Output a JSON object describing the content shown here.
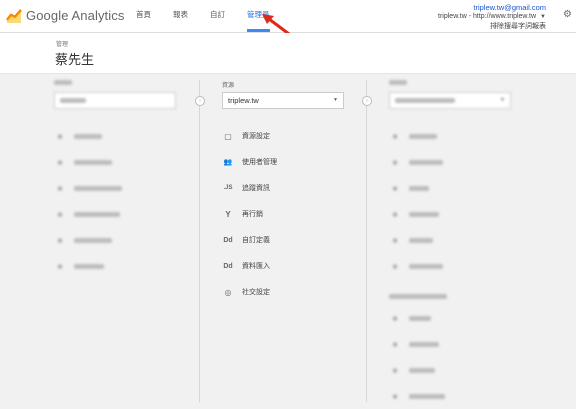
{
  "app": {
    "logo_text_google": "Google",
    "logo_text_product": " Analytics"
  },
  "nav": {
    "items": [
      "首頁",
      "報表",
      "自訂",
      "管理員"
    ],
    "active_index": 3
  },
  "account": {
    "email": "triplew.tw@gmail.com",
    "property_line": "triplew.tw - http://www.triplew.tw",
    "view_line": "排除搜尋字詞報表"
  },
  "header": {
    "crumb": "管理",
    "name": "蔡先生"
  },
  "property": {
    "label": "資源",
    "selected": "triplew.tw",
    "items": [
      {
        "icon": "page-icon",
        "glyph": "▢",
        "label": "資源設定"
      },
      {
        "icon": "users-icon",
        "glyph": "👥",
        "label": "使用者管理"
      },
      {
        "icon": "js-icon",
        "glyph": ".JS",
        "label": "追蹤資訊"
      },
      {
        "icon": "fork-icon",
        "glyph": "Y",
        "label": "再行銷"
      },
      {
        "icon": "dd-icon",
        "glyph": "Dd",
        "label": "自訂定義"
      },
      {
        "icon": "dd-icon",
        "glyph": "Dd",
        "label": "資料匯入"
      },
      {
        "icon": "globe-icon",
        "glyph": "◎",
        "label": "社交設定"
      }
    ]
  },
  "colors": {
    "accent": "#4285f4",
    "arrow": "#e0281c"
  }
}
